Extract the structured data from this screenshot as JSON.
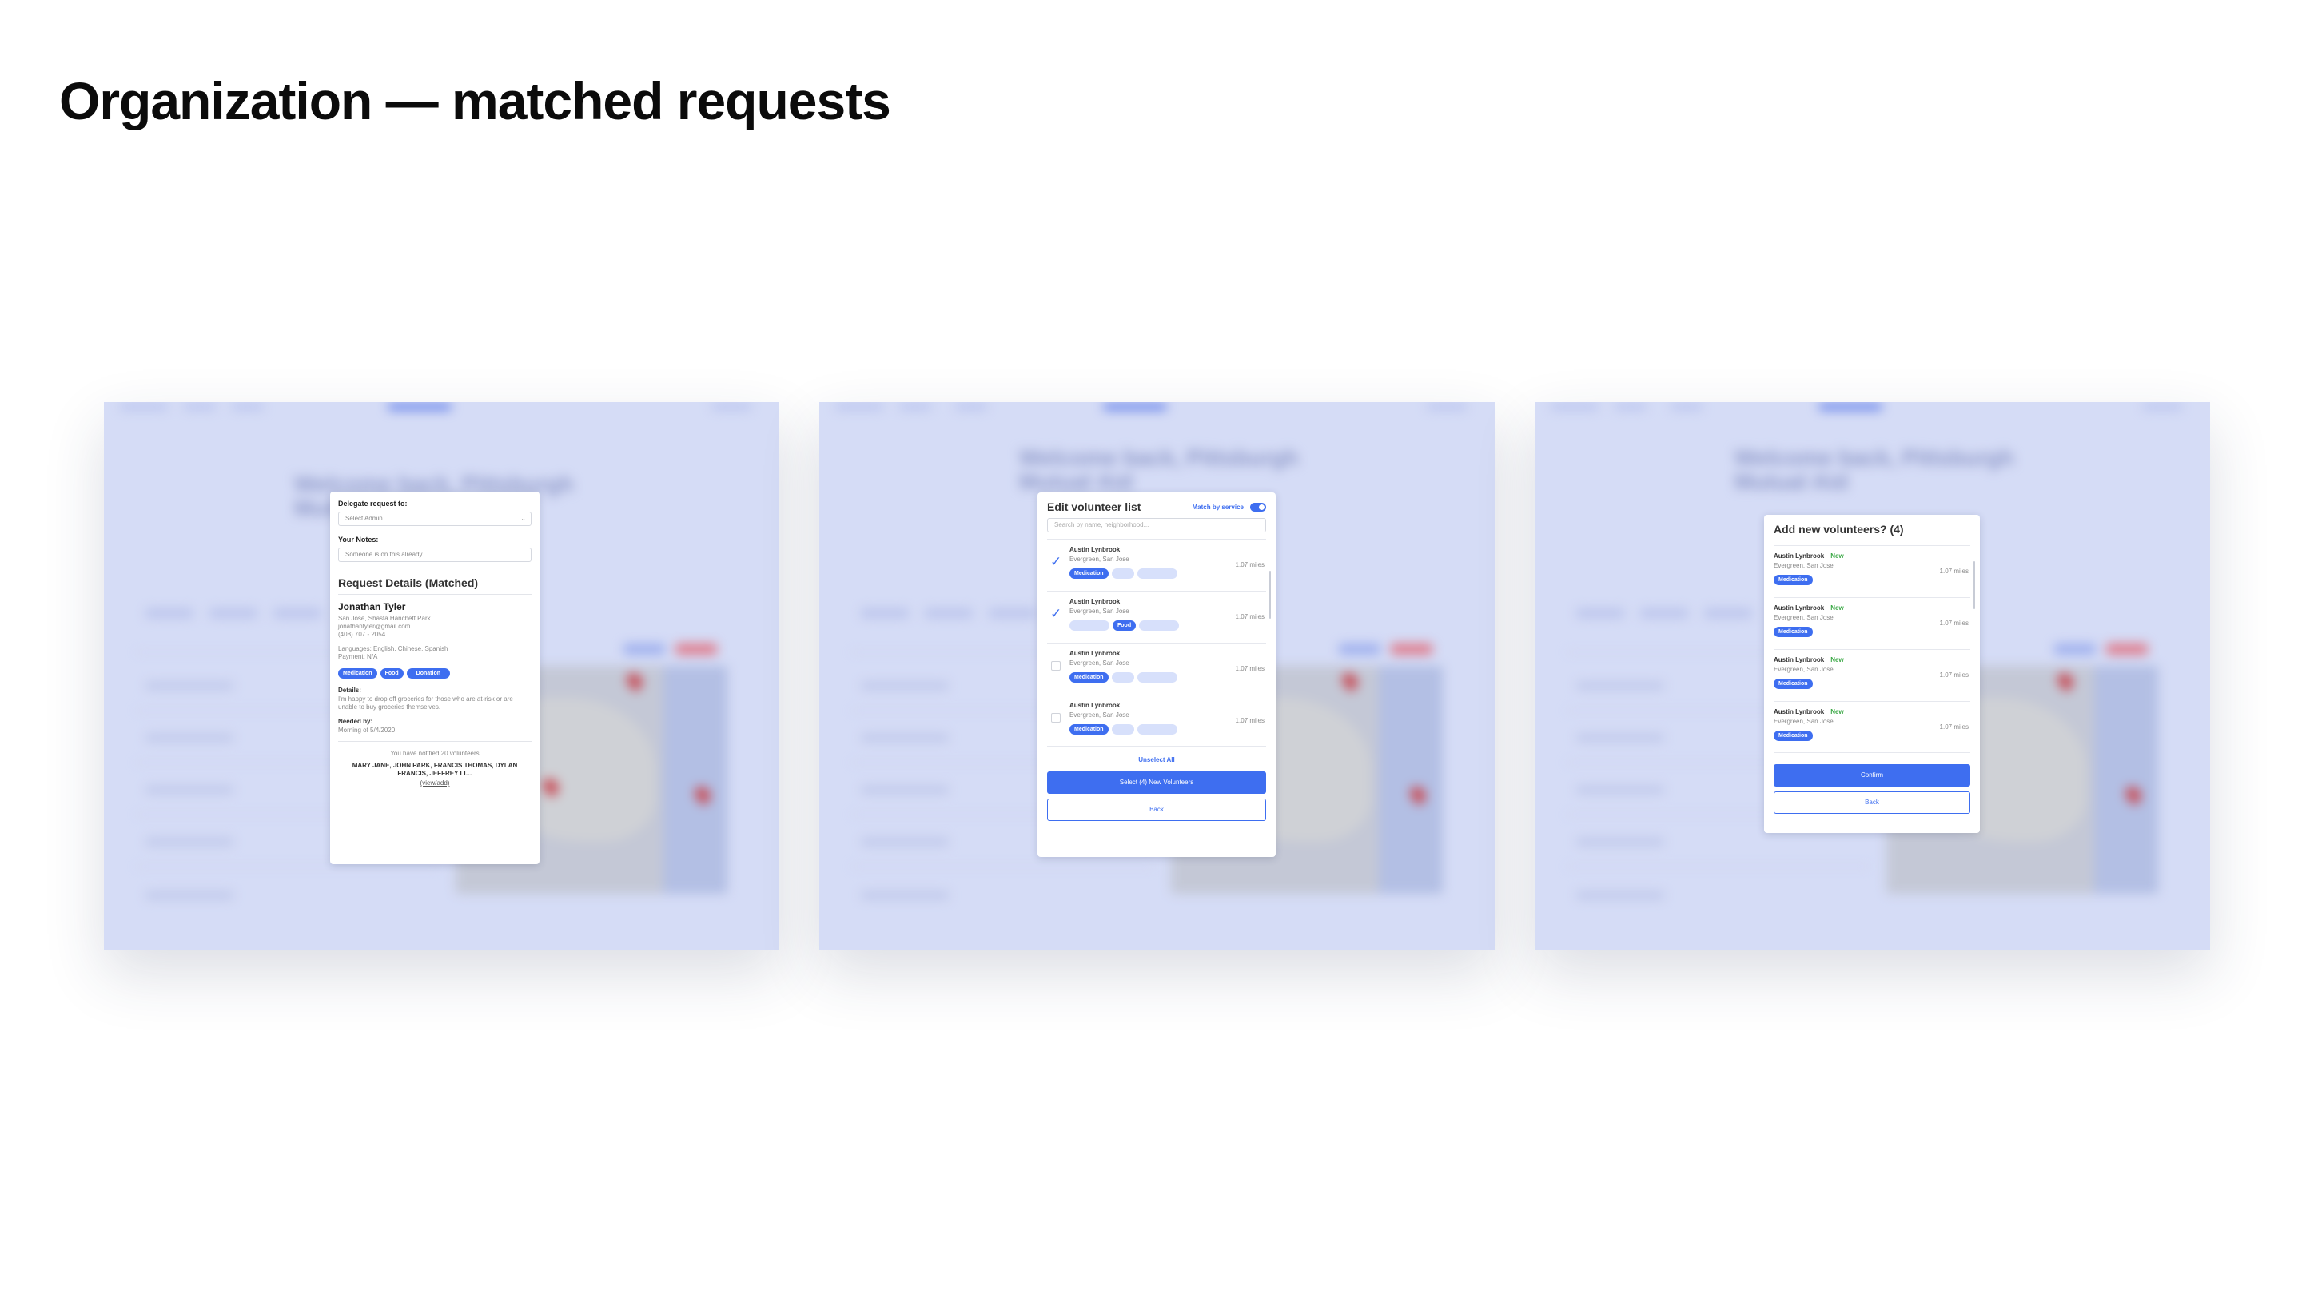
{
  "page": {
    "title": "Organization — matched requests"
  },
  "background": {
    "welcome": "Welcome back, Pittsburgh Mutual Aid"
  },
  "details_modal": {
    "delegate_label": "Delegate request to:",
    "delegate_placeholder": "Select Admin",
    "notes_label": "Your Notes:",
    "notes_value": "Someone is on this already",
    "section_title": "Request Details (Matched)",
    "requester_name": "Jonathan Tyler",
    "location": "San Jose, Shasta Hanchett Park",
    "email": "jonathantyler@gmail.com",
    "phone": "(408) 707 - 2054",
    "languages": "Languages: English, Chinese, Spanish",
    "payment": "Payment: N/A",
    "tags": [
      "Medication",
      "Food",
      "Donation"
    ],
    "details_label": "Details:",
    "details_text": "I'm happy to drop off groceries for those who are at-risk or are unable to buy groceries themselves.",
    "needed_label": "Needed by:",
    "needed_value": "Morning of 5/4/2020",
    "notified_text": "You have notified 20 volunteers",
    "volunteers_text": "MARY JANE, JOHN PARK, FRANCIS THOMAS, DYLAN FRANCIS, JEFFREY LI…",
    "view_add": "(view/add)"
  },
  "edit_modal": {
    "title": "Edit volunteer list",
    "match_label": "Match by service",
    "search_placeholder": "Search by name, neighborhood...",
    "items": [
      {
        "name": "Austin Lynbrook",
        "location": "Evergreen, San Jose",
        "distance": "1.07 miles",
        "checked": true,
        "active_tag": "Medication"
      },
      {
        "name": "Austin Lynbrook",
        "location": "Evergreen, San Jose",
        "distance": "1.07 miles",
        "checked": true,
        "active_tag": "Food"
      },
      {
        "name": "Austin Lynbrook",
        "location": "Evergreen, San Jose",
        "distance": "1.07 miles",
        "checked": false,
        "active_tag": "Medication"
      },
      {
        "name": "Austin Lynbrook",
        "location": "Evergreen, San Jose",
        "distance": "1.07 miles",
        "checked": false,
        "active_tag": "Medication"
      }
    ],
    "unselect_all": "Unselect All",
    "select_button": "Select (4) New Volunteers",
    "back_button": "Back"
  },
  "add_modal": {
    "title": "Add new volunteers? (4)",
    "new_badge": "New",
    "items": [
      {
        "name": "Austin Lynbrook",
        "location": "Evergreen, San Jose",
        "distance": "1.07 miles",
        "tag": "Medication"
      },
      {
        "name": "Austin Lynbrook",
        "location": "Evergreen, San Jose",
        "distance": "1.07 miles",
        "tag": "Medication"
      },
      {
        "name": "Austin Lynbrook",
        "location": "Evergreen, San Jose",
        "distance": "1.07 miles",
        "tag": "Medication"
      },
      {
        "name": "Austin Lynbrook",
        "location": "Evergreen, San Jose",
        "distance": "1.07 miles",
        "tag": "Medication"
      }
    ],
    "confirm_button": "Confirm",
    "back_button": "Back"
  },
  "colors": {
    "accent": "#3e6ef0",
    "panel_bg": "#d5dcf6",
    "new_badge": "#3aa845"
  }
}
